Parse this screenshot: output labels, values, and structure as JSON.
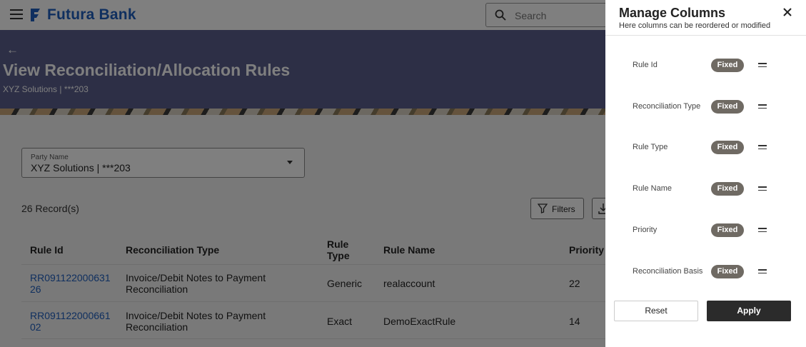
{
  "header": {
    "brand": "Futura Bank",
    "search_placeholder": "Search"
  },
  "page": {
    "back_icon": "back-arrow-icon",
    "title": "View Reconciliation/Allocation Rules",
    "subtitle": "XYZ Solutions | ***203"
  },
  "party": {
    "label": "Party Name",
    "value": "XYZ Solutions | ***203"
  },
  "toolbar": {
    "records": "26 Record(s)",
    "filters_label": "Filters"
  },
  "table": {
    "headers": [
      "Rule Id",
      "Reconciliation Type",
      "Rule\nType",
      "Rule Name",
      "Priority"
    ],
    "header_rule_type_line1": "Rule",
    "header_rule_type_line2": "Type",
    "rows": [
      {
        "rule_id_l1": "RR091122000631",
        "rule_id_l2": "26",
        "recon_type_l1": "Invoice/Debit Notes to Payment",
        "recon_type_l2": "Reconciliation",
        "rule_type": "Generic",
        "rule_name": "realaccount",
        "priority": "22"
      },
      {
        "rule_id_l1": "RR091122000661",
        "rule_id_l2": "02",
        "recon_type_l1": "Invoice/Debit Notes to Payment",
        "recon_type_l2": "Reconciliation",
        "rule_type": "Exact",
        "rule_name": "DemoExactRule",
        "priority": "14"
      }
    ]
  },
  "panel": {
    "title": "Manage Columns",
    "subtitle": "Here columns can be reordered or modified",
    "columns": [
      {
        "name": "Rule Id",
        "badge": "Fixed"
      },
      {
        "name": "Reconciliation Type",
        "badge": "Fixed"
      },
      {
        "name": "Rule Type",
        "badge": "Fixed"
      },
      {
        "name": "Rule Name",
        "badge": "Fixed"
      },
      {
        "name": "Priority",
        "badge": "Fixed"
      },
      {
        "name": "Reconciliation Basis",
        "badge": "Fixed"
      }
    ],
    "reset_label": "Reset",
    "apply_label": "Apply"
  },
  "colors": {
    "brand": "#1f5fbf",
    "banner": "#5a5f8c",
    "badge": "#6f6a63",
    "apply": "#2b2b2b"
  }
}
